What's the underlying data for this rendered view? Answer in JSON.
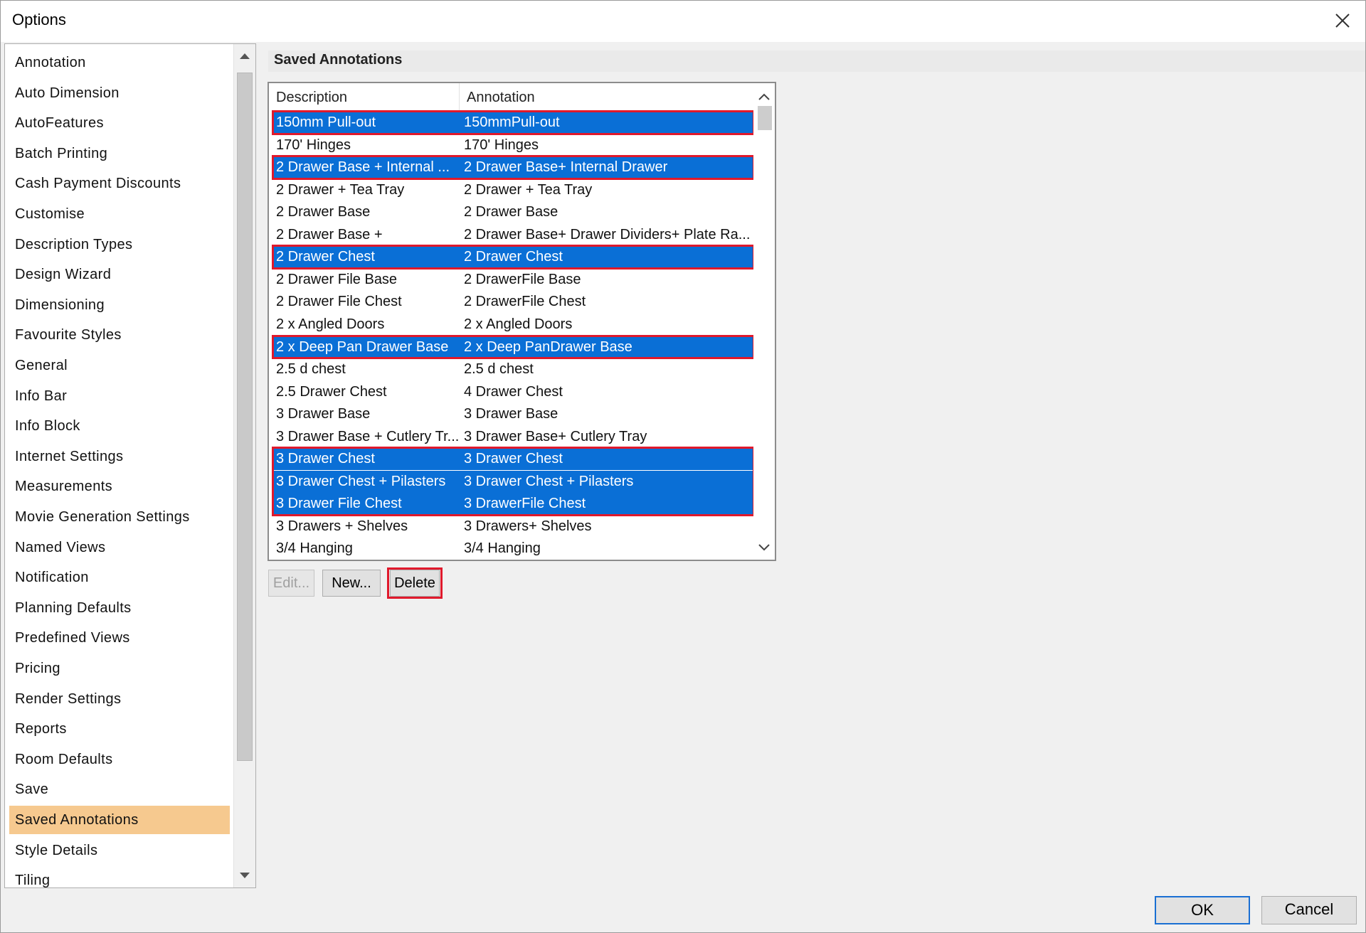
{
  "window": {
    "title": "Options"
  },
  "sidebar": {
    "items": [
      {
        "label": "Annotation"
      },
      {
        "label": "Auto Dimension"
      },
      {
        "label": "AutoFeatures"
      },
      {
        "label": "Batch Printing"
      },
      {
        "label": "Cash Payment Discounts"
      },
      {
        "label": "Customise"
      },
      {
        "label": "Description Types"
      },
      {
        "label": "Design Wizard"
      },
      {
        "label": "Dimensioning"
      },
      {
        "label": "Favourite Styles"
      },
      {
        "label": "General"
      },
      {
        "label": "Info Bar"
      },
      {
        "label": "Info Block"
      },
      {
        "label": "Internet Settings"
      },
      {
        "label": "Measurements"
      },
      {
        "label": "Movie Generation Settings"
      },
      {
        "label": "Named Views"
      },
      {
        "label": "Notification"
      },
      {
        "label": "Planning Defaults"
      },
      {
        "label": "Predefined Views"
      },
      {
        "label": "Pricing"
      },
      {
        "label": "Render Settings"
      },
      {
        "label": "Reports"
      },
      {
        "label": "Room Defaults"
      },
      {
        "label": "Save"
      },
      {
        "label": "Saved Annotations",
        "active": true
      },
      {
        "label": "Style Details"
      },
      {
        "label": "Tiling"
      }
    ]
  },
  "panel": {
    "title": "Saved Annotations"
  },
  "table": {
    "columns": [
      "Description",
      "Annotation"
    ],
    "rows": [
      {
        "description": "150mm Pull-out",
        "annotation": "150mmPull-out",
        "selected": true
      },
      {
        "description": "170' Hinges",
        "annotation": "170' Hinges",
        "selected": false
      },
      {
        "description": "2  Drawer Base + Internal ...",
        "annotation": "2  Drawer Base+ Internal Drawer",
        "selected": true
      },
      {
        "description": "2 Drawer + Tea Tray",
        "annotation": "2 Drawer + Tea Tray",
        "selected": false
      },
      {
        "description": "2 Drawer Base",
        "annotation": "2  Drawer Base",
        "selected": false
      },
      {
        "description": "2 Drawer Base +",
        "annotation": "2 Drawer Base+ Drawer Dividers+ Plate Ra...",
        "selected": false
      },
      {
        "description": "2 Drawer Chest",
        "annotation": "2 Drawer Chest",
        "selected": true
      },
      {
        "description": "2 Drawer File Base",
        "annotation": "2 DrawerFile Base",
        "selected": false
      },
      {
        "description": "2 Drawer File Chest",
        "annotation": "2 DrawerFile Chest",
        "selected": false
      },
      {
        "description": "2 x Angled Doors",
        "annotation": "2 x Angled Doors",
        "selected": false
      },
      {
        "description": "2 x Deep Pan Drawer Base",
        "annotation": "2 x Deep PanDrawer Base",
        "selected": true
      },
      {
        "description": "2.5 d chest",
        "annotation": "2.5 d chest",
        "selected": false
      },
      {
        "description": "2.5 Drawer Chest",
        "annotation": "4 Drawer Chest",
        "selected": false
      },
      {
        "description": "3 Drawer Base",
        "annotation": "3 Drawer Base",
        "selected": false
      },
      {
        "description": "3 Drawer Base + Cutlery Tr...",
        "annotation": "3 Drawer Base+ Cutlery Tray",
        "selected": false
      },
      {
        "description": "3 Drawer Chest",
        "annotation": "3 Drawer Chest",
        "selected": true
      },
      {
        "description": "3 Drawer Chest + Pilasters",
        "annotation": "3 Drawer Chest + Pilasters",
        "selected": true
      },
      {
        "description": "3 Drawer File Chest",
        "annotation": "3 DrawerFile Chest",
        "selected": true
      },
      {
        "description": "3 Drawers + Shelves",
        "annotation": "3 Drawers+ Shelves",
        "selected": false
      },
      {
        "description": "3/4 Hanging",
        "annotation": "3/4 Hanging",
        "selected": false
      }
    ]
  },
  "buttons": {
    "edit": "Edit...",
    "new": "New...",
    "delete": "Delete"
  },
  "footer": {
    "ok": "OK",
    "cancel": "Cancel"
  },
  "colors": {
    "selection": "#0a6fd6",
    "highlight_box": "#e0192c",
    "active_nav": "#f6c98f"
  }
}
